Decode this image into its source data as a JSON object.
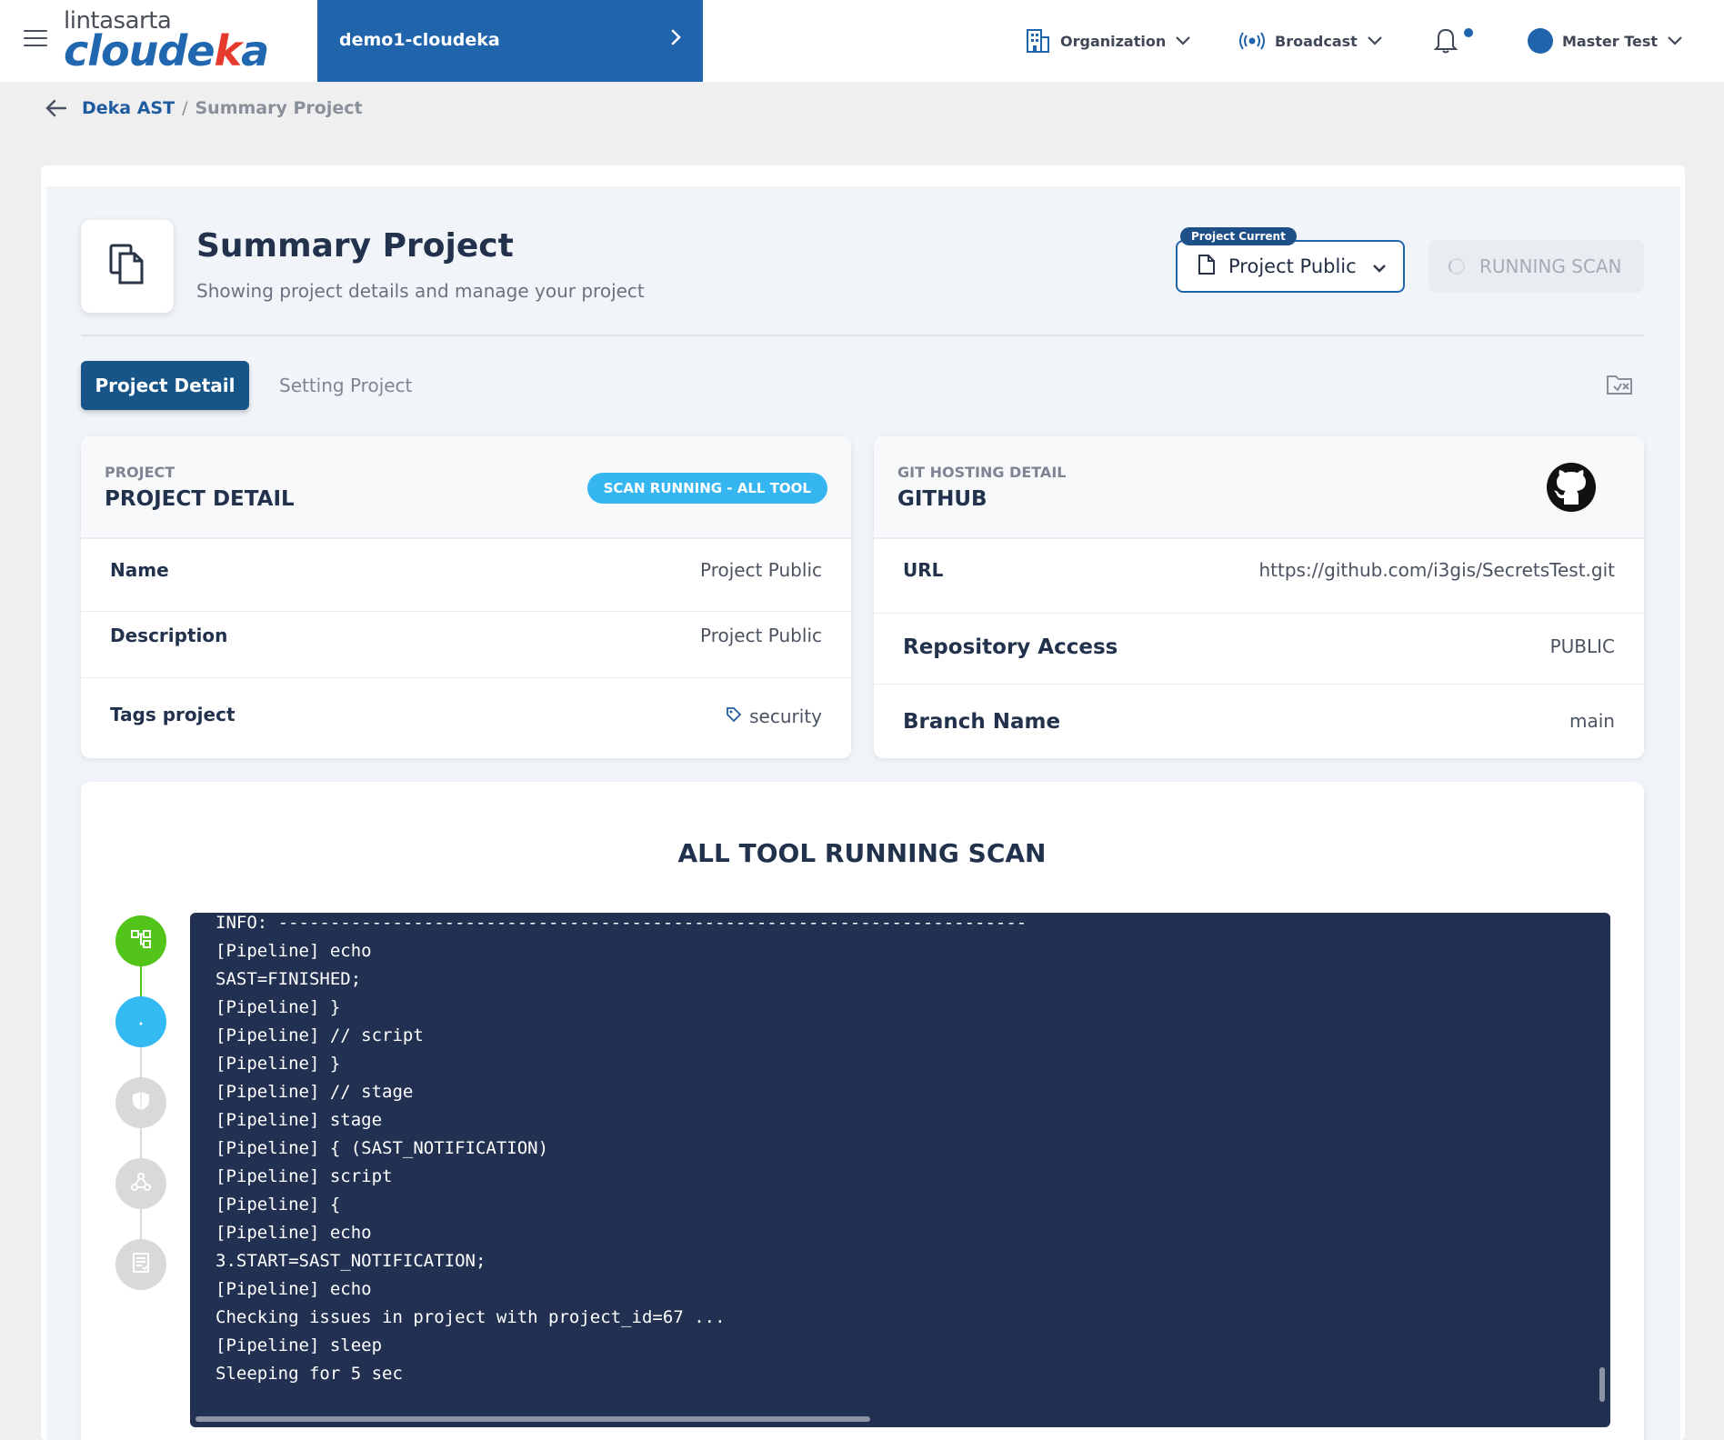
{
  "topbar": {
    "logo_top": "lintasarta",
    "logo_bottom_a": "cloude",
    "logo_bottom_b": "k",
    "logo_bottom_c": "a",
    "project_name": "demo1-cloudeka",
    "organization_label": "Organization",
    "broadcast_label": "Broadcast",
    "user_label": "Master Test"
  },
  "breadcrumb": {
    "parent": "Deka AST",
    "separator": "/",
    "current": "Summary Project"
  },
  "header": {
    "title": "Summary Project",
    "subtitle": "Showing project details and manage your project",
    "current_badge": "Project Current",
    "project_select_value": "Project Public",
    "running_button": "RUNNING SCAN"
  },
  "tabs": {
    "active": "Project Detail",
    "inactive": "Setting Project"
  },
  "project_card": {
    "eyebrow": "PROJECT",
    "heading": "PROJECT DETAIL",
    "status": "SCAN RUNNING - ALL TOOL",
    "rows": [
      {
        "key": "Name",
        "value": "Project Public"
      },
      {
        "key": "Description",
        "value": "Project Public"
      },
      {
        "key": "Tags project",
        "value": "security"
      }
    ]
  },
  "git_card": {
    "eyebrow": "GIT HOSTING DETAIL",
    "heading": "GITHUB",
    "rows": [
      {
        "key": "URL",
        "value": "https://github.com/i3gis/SecretsTest.git"
      },
      {
        "key": "Repository Access",
        "value": "PUBLIC"
      },
      {
        "key": "Branch Name",
        "value": "main"
      }
    ]
  },
  "scan": {
    "title": "ALL TOOL RUNNING SCAN",
    "log_lines": [
      "INFO: ------------------------------------------------------------------------",
      "[Pipeline] echo",
      "SAST=FINISHED;",
      "[Pipeline] }",
      "[Pipeline] // script",
      "[Pipeline] }",
      "[Pipeline] // stage",
      "[Pipeline] stage",
      "[Pipeline] { (SAST_NOTIFICATION)",
      "[Pipeline] script",
      "[Pipeline] {",
      "[Pipeline] echo",
      "3.START=SAST_NOTIFICATION;",
      "[Pipeline] echo",
      "Checking issues in project with project_id=67 ...",
      "[Pipeline] sleep",
      "Sleeping for 5 sec"
    ],
    "steps": [
      {
        "icon": "pipeline-icon",
        "state": "done",
        "color": "#52c41a"
      },
      {
        "icon": "loading-icon",
        "state": "running",
        "color": "#33baf2"
      },
      {
        "icon": "shield-icon",
        "state": "pending",
        "color": "#d9d9d9"
      },
      {
        "icon": "webhook-icon",
        "state": "pending",
        "color": "#d9d9d9"
      },
      {
        "icon": "report-icon",
        "state": "pending",
        "color": "#d9d9d9"
      }
    ]
  },
  "colors": {
    "brand": "#2064ac",
    "accent_red": "#e63a2f",
    "tab_active": "#175487",
    "status_pill": "#36b6f1",
    "terminal_bg": "#223152"
  }
}
